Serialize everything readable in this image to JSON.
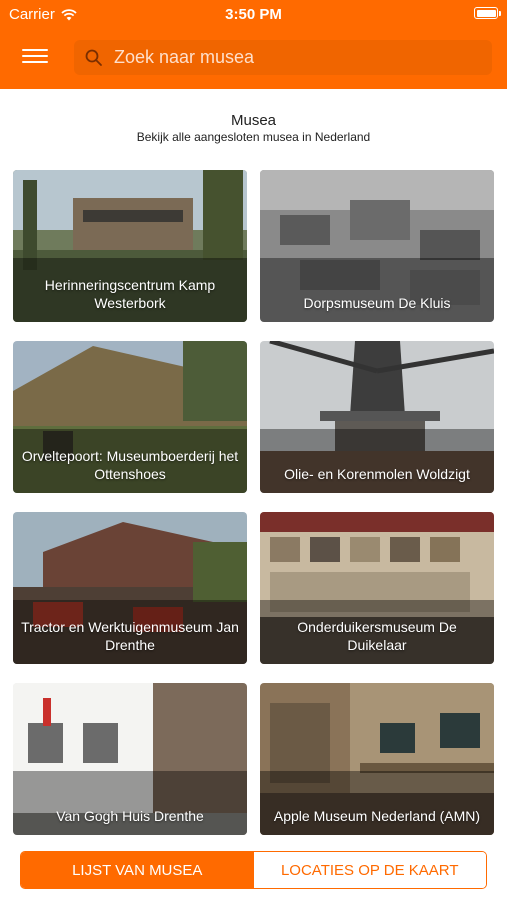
{
  "status_bar": {
    "carrier": "Carrier",
    "time": "3:50 PM"
  },
  "search": {
    "placeholder": "Zoek naar musea"
  },
  "heading": {
    "title": "Musea",
    "subtitle": "Bekijk alle aangesloten musea in Nederland"
  },
  "museums": [
    {
      "name": "Herinneringscentrum Kamp Westerbork"
    },
    {
      "name": "Dorpsmuseum De Kluis"
    },
    {
      "name": "Orveltepoort: Museumboerderij het Ottenshoes"
    },
    {
      "name": "Olie- en Korenmolen Woldzigt"
    },
    {
      "name": "Tractor en Werktuigenmuseum Jan Drenthe"
    },
    {
      "name": "Onderduikersmuseum De Duikelaar"
    },
    {
      "name": "Van Gogh Huis Drenthe"
    },
    {
      "name": "Apple Museum Nederland (AMN)"
    }
  ],
  "tabs": {
    "list": "LIJST VAN MUSEA",
    "map": "LOCATIES OP DE KAART"
  },
  "colors": {
    "accent": "#ff6a00"
  },
  "icons": [
    "wifi-icon",
    "battery-icon",
    "hamburger-menu-icon",
    "search-icon"
  ]
}
